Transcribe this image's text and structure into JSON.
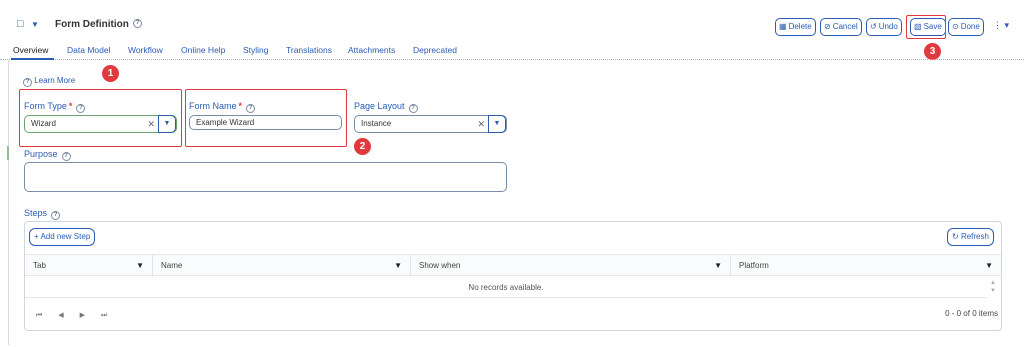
{
  "header": {
    "title": "Form Definition",
    "toolbar": {
      "delete": "Delete",
      "cancel": "Cancel",
      "undo": "Undo",
      "save": "Save",
      "done": "Done"
    }
  },
  "tabs": [
    "Overview",
    "Data Model",
    "Workflow",
    "Online Help",
    "Styling",
    "Translations",
    "Attachments",
    "Deprecated"
  ],
  "overview": {
    "learn_more": "Learn More",
    "form_type": {
      "label": "Form Type",
      "value": "Wizard"
    },
    "form_name": {
      "label": "Form Name",
      "value": "Example Wizard"
    },
    "page_layout": {
      "label": "Page Layout",
      "value": "Instance"
    },
    "purpose": {
      "label": "Purpose",
      "value": ""
    },
    "steps": {
      "label": "Steps",
      "add_button": "Add new Step",
      "refresh_button": "Refresh",
      "columns": [
        "Tab",
        "Name",
        "Show when",
        "Platform"
      ],
      "empty_message": "No records available.",
      "pager_info": "0 - 0 of 0 items"
    }
  },
  "callouts": [
    "1",
    "2",
    "3"
  ],
  "colors": {
    "accent": "#2a5cb5",
    "callout": "#e03a3e",
    "required": "#e03a3e"
  }
}
